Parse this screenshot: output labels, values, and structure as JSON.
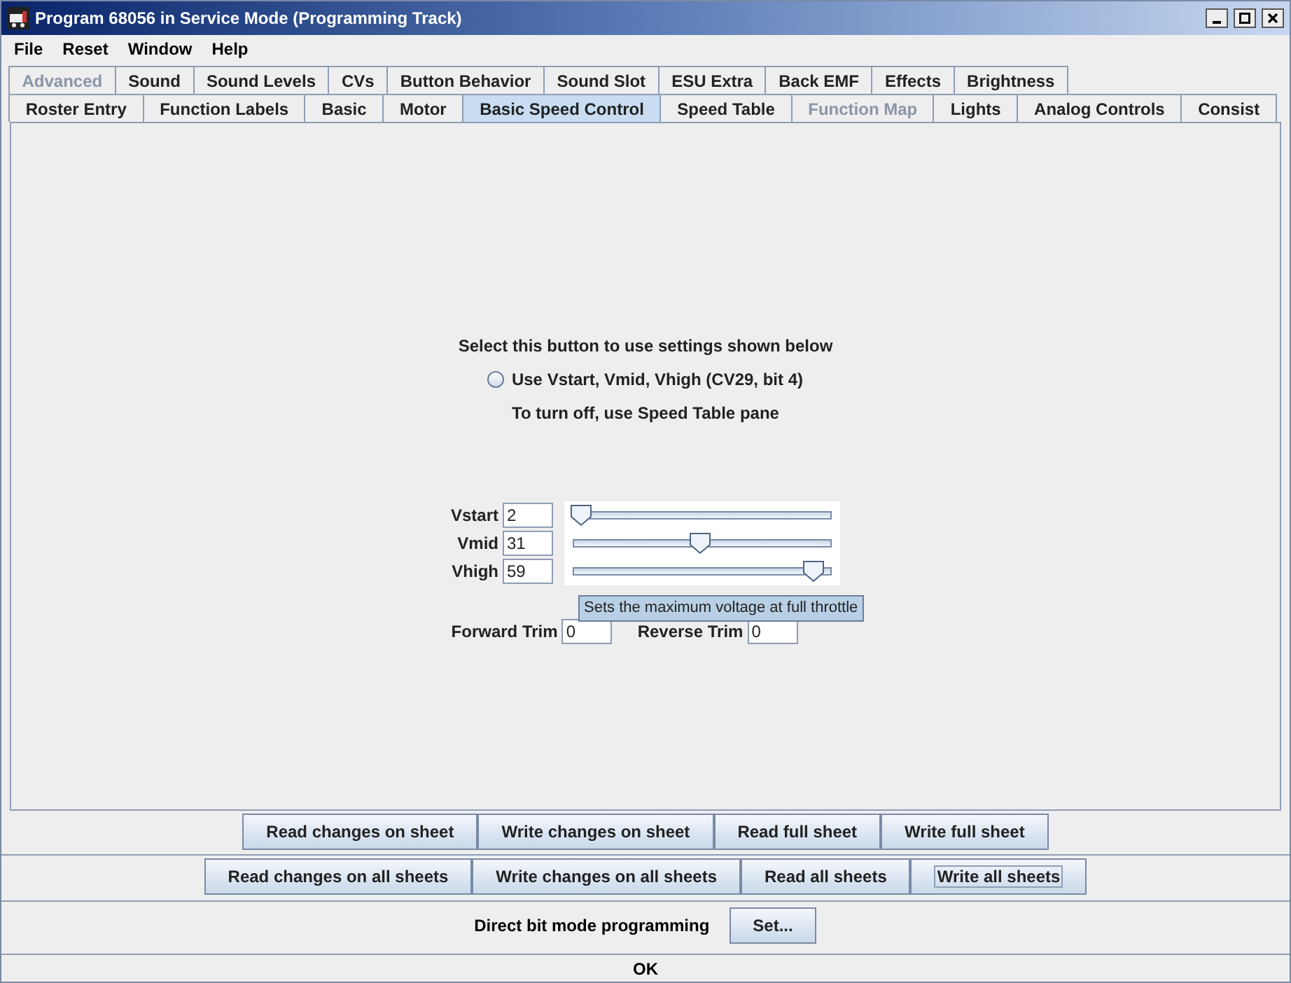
{
  "window": {
    "title": "Program 68056 in Service Mode (Programming Track)"
  },
  "menu": [
    "File",
    "Reset",
    "Window",
    "Help"
  ],
  "tab_rows": [
    [
      {
        "label": "Advanced",
        "selected": false,
        "disabled": true
      },
      {
        "label": "Sound",
        "selected": false,
        "disabled": false
      },
      {
        "label": "Sound Levels",
        "selected": false,
        "disabled": false
      },
      {
        "label": "CVs",
        "selected": false,
        "disabled": false
      },
      {
        "label": "Button Behavior",
        "selected": false,
        "disabled": false
      },
      {
        "label": "Sound Slot",
        "selected": false,
        "disabled": false
      },
      {
        "label": "ESU Extra",
        "selected": false,
        "disabled": false
      },
      {
        "label": "Back EMF",
        "selected": false,
        "disabled": false
      },
      {
        "label": "Effects",
        "selected": false,
        "disabled": false
      },
      {
        "label": "Brightness",
        "selected": false,
        "disabled": false
      }
    ],
    [
      {
        "label": "Roster Entry",
        "selected": false,
        "disabled": false
      },
      {
        "label": "Function Labels",
        "selected": false,
        "disabled": false
      },
      {
        "label": "Basic",
        "selected": false,
        "disabled": false
      },
      {
        "label": "Motor",
        "selected": false,
        "disabled": false
      },
      {
        "label": "Basic Speed Control",
        "selected": true,
        "disabled": false
      },
      {
        "label": "Speed Table",
        "selected": false,
        "disabled": false
      },
      {
        "label": "Function Map",
        "selected": false,
        "disabled": true
      },
      {
        "label": "Lights",
        "selected": false,
        "disabled": false
      },
      {
        "label": "Analog Controls",
        "selected": false,
        "disabled": false
      },
      {
        "label": "Consist",
        "selected": false,
        "disabled": false
      }
    ]
  ],
  "pane": {
    "intro": "Select this button to use settings shown below",
    "radio": {
      "label": "Use Vstart, Vmid, Vhigh (CV29, bit 4)",
      "checked": false
    },
    "note": "To turn off, use Speed Table pane",
    "voltages": [
      {
        "label": "Vstart",
        "value": "2",
        "level": 0.03
      },
      {
        "label": "Vmid",
        "value": "31",
        "level": 0.49
      },
      {
        "label": "Vhigh",
        "value": "59",
        "level": 0.93
      }
    ],
    "tooltip": "Sets the maximum voltage at full throttle",
    "trims": [
      {
        "label": "Forward Trim",
        "value": "0"
      },
      {
        "label": "Reverse Trim",
        "value": "0"
      }
    ]
  },
  "sheet_buttons": [
    "Read changes on sheet",
    "Write changes on sheet",
    "Read full sheet",
    "Write full sheet"
  ],
  "all_buttons": [
    {
      "label": "Read changes on all sheets",
      "focused": false
    },
    {
      "label": "Write changes on all sheets",
      "focused": false
    },
    {
      "label": "Read all sheets",
      "focused": false
    },
    {
      "label": "Write all sheets",
      "focused": true
    }
  ],
  "direct": {
    "label": "Direct bit mode programming",
    "button": "Set..."
  },
  "status_bar": "OK"
}
